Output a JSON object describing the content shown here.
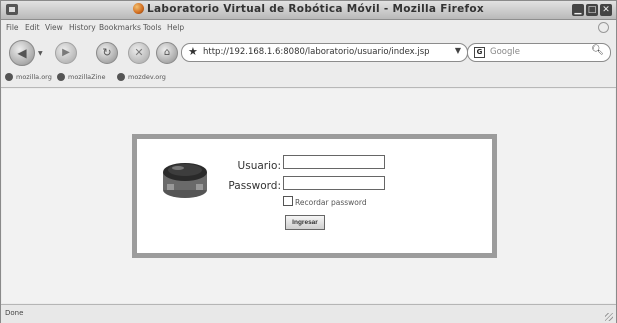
{
  "window": {
    "title": "Laboratorio Virtual de Robótica Móvil - Mozilla Firefox"
  },
  "menu": [
    "File",
    "Edit",
    "View",
    "History",
    "Bookmarks",
    "Tools",
    "Help"
  ],
  "toolbar": {
    "url": "http://192.168.1.6:8080/laboratorio/usuario/index.jsp",
    "search_placeholder": "Google"
  },
  "bookmarks": [
    {
      "label": "mozilla.org",
      "icon": "mozilla-icon"
    },
    {
      "label": "mozillaZine",
      "icon": "mozillazine-icon"
    },
    {
      "label": "mozdev.org",
      "icon": "mozdev-icon"
    }
  ],
  "login": {
    "username_label": "Usuario:",
    "password_label": "Password:",
    "username_value": "",
    "password_value": "",
    "remember_label": "Recordar password",
    "remember_checked": false,
    "submit_label": "Ingresar",
    "robot_icon": "robot-icon"
  },
  "status": {
    "text": "Done"
  }
}
